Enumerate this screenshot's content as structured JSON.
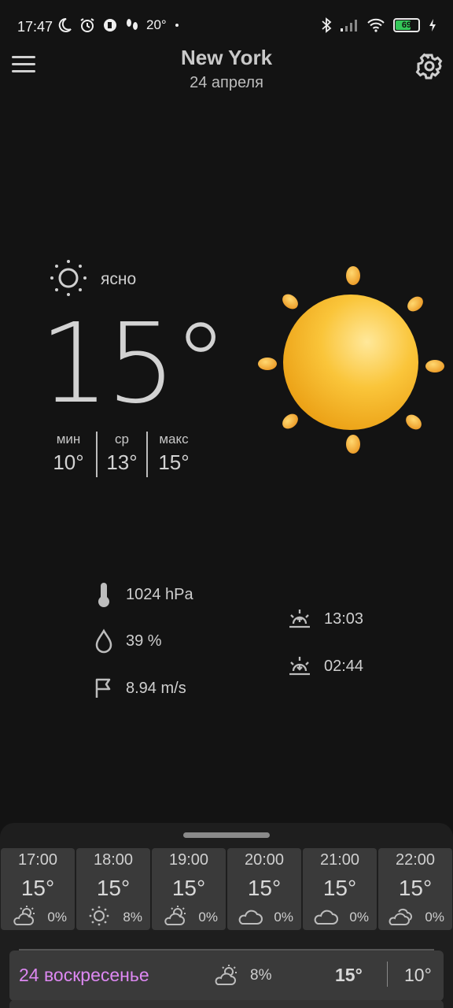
{
  "status_bar": {
    "time": "17:47",
    "temp": "20°",
    "battery": "69",
    "icons": [
      "moon-icon",
      "alarm-icon",
      "app-icon",
      "steps-icon",
      "dot-icon",
      "bluetooth-icon",
      "signal-icon",
      "wifi-icon",
      "battery-icon",
      "charging-icon"
    ]
  },
  "header": {
    "city": "New York",
    "date": "24 апреля"
  },
  "current": {
    "condition": "ясно",
    "temperature": "15°",
    "min_label": "мин",
    "min": "10°",
    "avg_label": "ср",
    "avg": "13°",
    "max_label": "макс",
    "max": "15°"
  },
  "details": {
    "pressure": "1024 hPa",
    "humidity": "39 %",
    "wind": "8.94 m/s",
    "sunrise": "13:03",
    "sunset": "02:44"
  },
  "hourly": [
    {
      "time": "17:00",
      "temp": "15°",
      "precip": "0%",
      "icon": "partly-cloudy-icon"
    },
    {
      "time": "18:00",
      "temp": "15°",
      "precip": "8%",
      "icon": "sun-icon"
    },
    {
      "time": "19:00",
      "temp": "15°",
      "precip": "0%",
      "icon": "partly-cloudy-icon"
    },
    {
      "time": "20:00",
      "temp": "15°",
      "precip": "0%",
      "icon": "cloud-icon"
    },
    {
      "time": "21:00",
      "temp": "15°",
      "precip": "0%",
      "icon": "cloud-icon"
    },
    {
      "time": "22:00",
      "temp": "15°",
      "precip": "0%",
      "icon": "clouds-icon"
    }
  ],
  "daily": [
    {
      "label": "24 воскресенье",
      "precip": "8%",
      "max": "15°",
      "min": "10°",
      "icon": "partly-cloudy-icon"
    }
  ],
  "colors": {
    "background": "#131313",
    "day_label": "#dd88f2",
    "card": "#3a3a3a",
    "sun": "#f5b820"
  }
}
